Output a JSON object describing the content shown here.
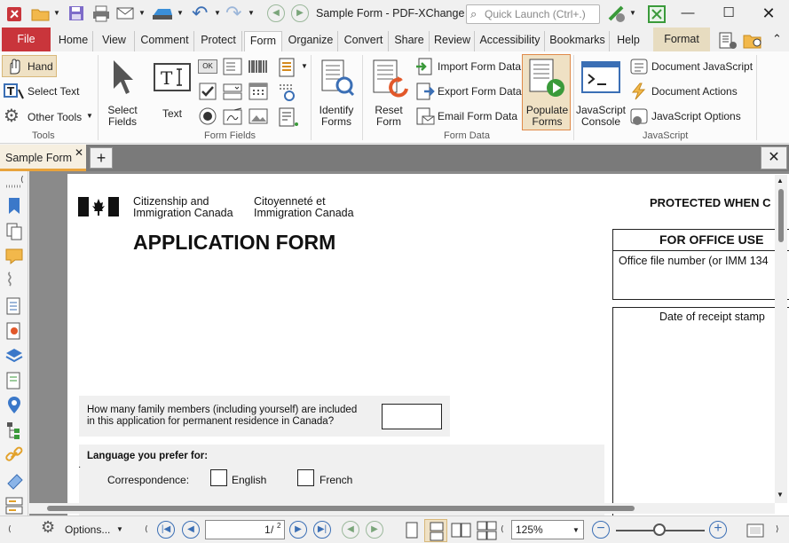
{
  "window": {
    "title": "Sample Form - PDF-XChange ..",
    "quick_launch_placeholder": "Quick Launch (Ctrl+.)"
  },
  "tabs": [
    "File",
    "Home",
    "View",
    "Comment",
    "Protect",
    "Form",
    "Organize",
    "Convert",
    "Share",
    "Review",
    "Accessibility",
    "Bookmarks",
    "Help",
    "Format"
  ],
  "ribbon": {
    "tools": {
      "hand": "Hand",
      "select_text": "Select Text",
      "other_tools": "Other Tools",
      "group": "Tools"
    },
    "form_fields": {
      "select_fields_1": "Select",
      "select_fields_2": "Fields",
      "text": "Text",
      "ok": "OK",
      "group": "Form Fields"
    },
    "identify_1": "Identify",
    "identify_2": "Forms",
    "reset_1": "Reset",
    "reset_2": "Form",
    "form_data": {
      "import": "Import Form Data",
      "export": "Export Form Data",
      "email": "Email Form Data",
      "group": "Form Data"
    },
    "populate_1": "Populate",
    "populate_2": "Forms",
    "js": {
      "console_1": "JavaScript",
      "console_2": "Console",
      "document": "Document JavaScript",
      "actions": "Document Actions",
      "options": "JavaScript Options",
      "group": "JavaScript"
    }
  },
  "document_tab": {
    "label": "Sample Form"
  },
  "page": {
    "dept_en_1": "Citizenship and",
    "dept_en_2": "Immigration Canada",
    "dept_fr_1": "Citoyenneté et",
    "dept_fr_2": "Immigration Canada",
    "protected": "PROTECTED WHEN C",
    "title": "APPLICATION FORM",
    "office_use": "FOR OFFICE USE",
    "office_file": "Office file number (or IMM 134",
    "receipt_stamp": "Date of receipt stamp",
    "family_q_1": "How many family members (including yourself) are included",
    "family_q_2": "in this application for permanent residence in Canada?",
    "language": "Language you prefer for:",
    "correspondence": "Correspondence:",
    "english": "English",
    "french": "French"
  },
  "statusbar": {
    "options": "Options...",
    "page_current": "1",
    "page_total": "2",
    "zoom": "125%"
  },
  "colors": {
    "file_tab": "#c9353b",
    "accent_orange": "#e8a33c",
    "highlight": "#efe1c4",
    "blue": "#3b6fb5"
  }
}
